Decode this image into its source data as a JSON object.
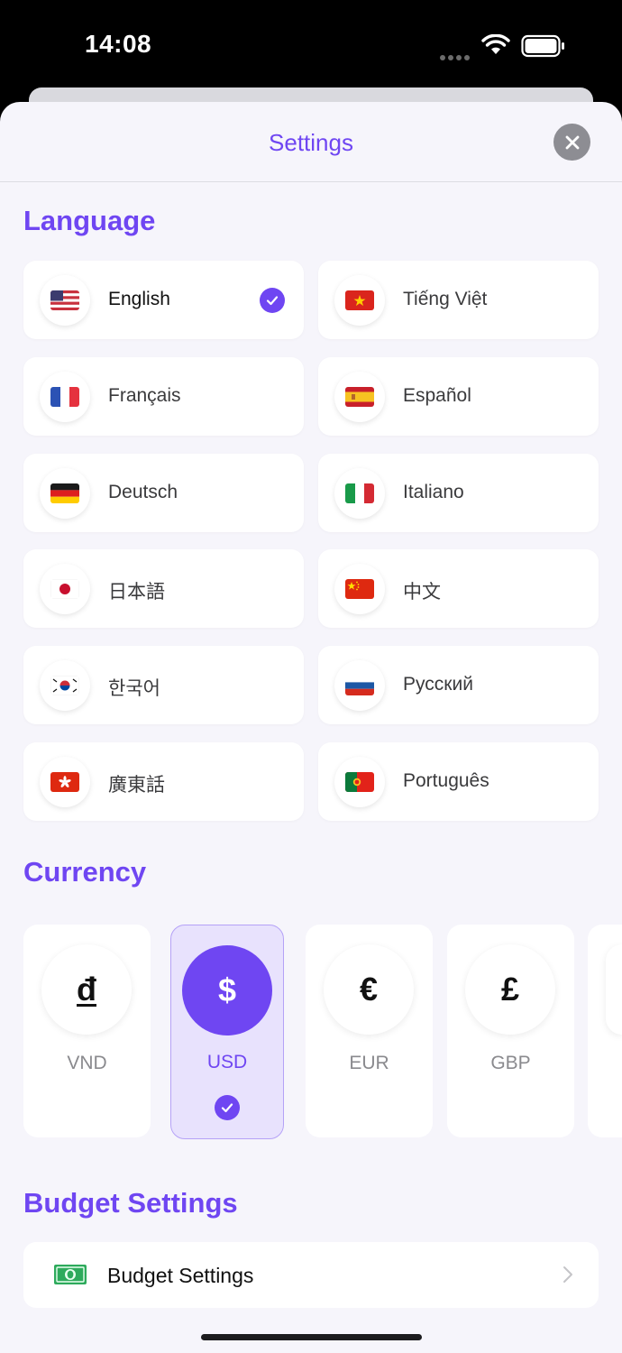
{
  "status_bar": {
    "time": "14:08"
  },
  "header": {
    "title": "Settings"
  },
  "language": {
    "title": "Language",
    "items": [
      {
        "label": "English",
        "flag": "us-flag-icon",
        "selected": true
      },
      {
        "label": "Tiếng Việt",
        "flag": "vietnam-flag-icon",
        "selected": false
      },
      {
        "label": "Français",
        "flag": "france-flag-icon",
        "selected": false
      },
      {
        "label": "Español",
        "flag": "spain-flag-icon",
        "selected": false
      },
      {
        "label": "Deutsch",
        "flag": "germany-flag-icon",
        "selected": false
      },
      {
        "label": "Italiano",
        "flag": "italy-flag-icon",
        "selected": false
      },
      {
        "label": "日本語",
        "flag": "japan-flag-icon",
        "selected": false
      },
      {
        "label": "中文",
        "flag": "china-flag-icon",
        "selected": false
      },
      {
        "label": "한국어",
        "flag": "korea-flag-icon",
        "selected": false
      },
      {
        "label": "Русский",
        "flag": "russia-flag-icon",
        "selected": false
      },
      {
        "label": "廣東話",
        "flag": "hong-kong-flag-icon",
        "selected": false
      },
      {
        "label": "Português",
        "flag": "portugal-flag-icon",
        "selected": false
      }
    ]
  },
  "currency": {
    "title": "Currency",
    "items": [
      {
        "symbol": "đ",
        "code": "VND",
        "selected": false
      },
      {
        "symbol": "$",
        "code": "USD",
        "selected": true
      },
      {
        "symbol": "€",
        "code": "EUR",
        "selected": false
      },
      {
        "symbol": "£",
        "code": "GBP",
        "selected": false
      }
    ]
  },
  "budget": {
    "title": "Budget Settings",
    "row_label": "Budget Settings",
    "icon": "money-bill-icon"
  },
  "colors": {
    "accent": "#6f46f2",
    "selected_bg": "#e8e2fd",
    "sheet_bg": "#f6f5fb"
  }
}
